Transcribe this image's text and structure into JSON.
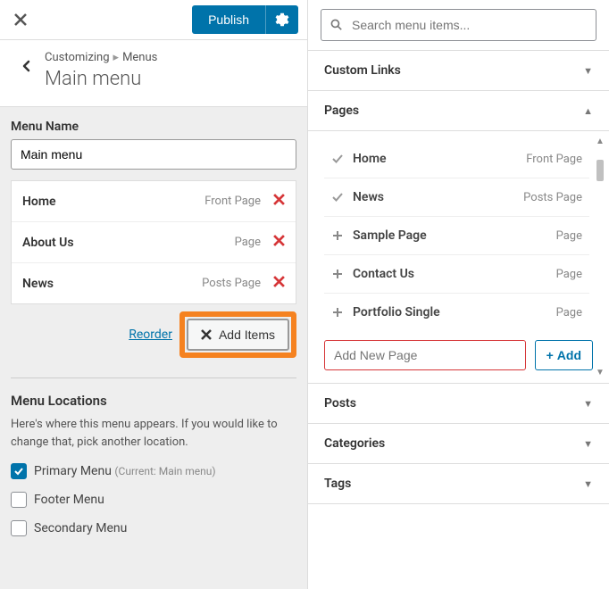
{
  "topbar": {
    "publish": "Publish"
  },
  "breadcrumb": {
    "customizing": "Customizing",
    "section": "Menus",
    "title": "Main menu"
  },
  "menuName": {
    "label": "Menu Name",
    "value": "Main menu"
  },
  "menuItems": [
    {
      "title": "Home",
      "type": "Front Page"
    },
    {
      "title": "About Us",
      "type": "Page"
    },
    {
      "title": "News",
      "type": "Posts Page"
    }
  ],
  "actions": {
    "reorder": "Reorder",
    "addItems": "Add Items"
  },
  "locations": {
    "title": "Menu Locations",
    "desc": "Here's where this menu appears. If you would like to change that, pick another location.",
    "items": [
      {
        "label": "Primary Menu",
        "current": "(Current: Main menu)",
        "checked": true
      },
      {
        "label": "Footer Menu",
        "current": "",
        "checked": false
      },
      {
        "label": "Secondary Menu",
        "current": "",
        "checked": false
      }
    ]
  },
  "search": {
    "placeholder": "Search menu items..."
  },
  "accordions": {
    "customLinks": "Custom Links",
    "pages": "Pages",
    "posts": "Posts",
    "categories": "Categories",
    "tags": "Tags"
  },
  "pages": [
    {
      "title": "Home",
      "type": "Front Page",
      "added": true
    },
    {
      "title": "News",
      "type": "Posts Page",
      "added": true
    },
    {
      "title": "Sample Page",
      "type": "Page",
      "added": false
    },
    {
      "title": "Contact Us",
      "type": "Page",
      "added": false
    },
    {
      "title": "Portfolio Single",
      "type": "Page",
      "added": false
    }
  ],
  "addPage": {
    "placeholder": "Add New Page",
    "button": "Add"
  }
}
